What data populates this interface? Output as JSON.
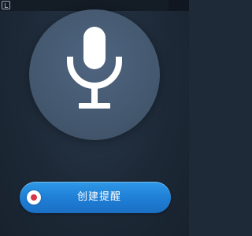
{
  "status_bar": {
    "icon": "app-shortcut-icon"
  },
  "voice": {
    "mic_icon": "microphone-icon"
  },
  "create_button": {
    "label": "创建提醒",
    "icon": "record-dot-icon",
    "accent_color": "#1f7fd6",
    "record_color": "#d8344a"
  }
}
